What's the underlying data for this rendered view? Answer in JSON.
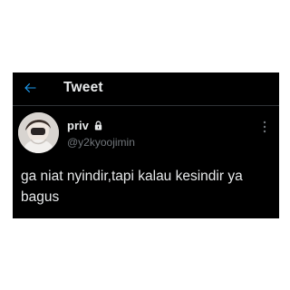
{
  "colors": {
    "background": "#000000",
    "accent": "#1d9bf0",
    "text_primary": "#e7e9ea",
    "text_secondary": "#71767b",
    "divider": "#2f3336"
  },
  "header": {
    "back_icon": "arrow-left-icon",
    "title": "Tweet"
  },
  "tweet": {
    "author": {
      "display_name": "priv",
      "protected_icon": "lock-icon",
      "username": "@y2kyoojimin"
    },
    "more_icon": "more-vertical-icon",
    "text": "ga niat nyindir,tapi kalau kesindir ya bagus"
  }
}
